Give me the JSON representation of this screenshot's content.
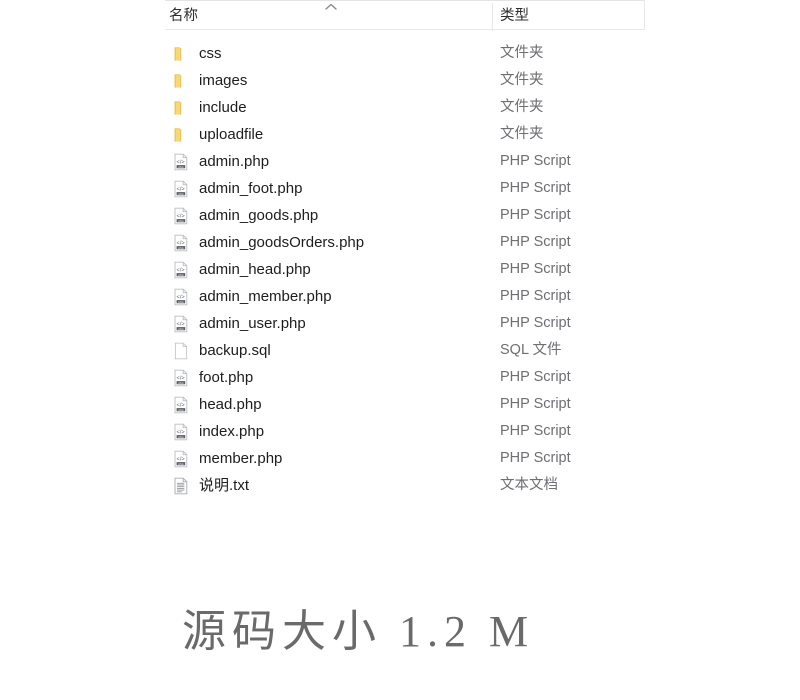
{
  "explorer": {
    "columns": {
      "name_label": "名称",
      "type_label": "类型",
      "sort_icon": "chevron-up-icon",
      "sort_direction": "ascending"
    },
    "rows": [
      {
        "name": "css",
        "type": "文件夹",
        "icon": "folder-icon"
      },
      {
        "name": "images",
        "type": "文件夹",
        "icon": "folder-icon"
      },
      {
        "name": "include",
        "type": "文件夹",
        "icon": "folder-icon"
      },
      {
        "name": "uploadfile",
        "type": "文件夹",
        "icon": "folder-icon"
      },
      {
        "name": "admin.php",
        "type": "PHP Script",
        "icon": "php-file-icon"
      },
      {
        "name": "admin_foot.php",
        "type": "PHP Script",
        "icon": "php-file-icon"
      },
      {
        "name": "admin_goods.php",
        "type": "PHP Script",
        "icon": "php-file-icon"
      },
      {
        "name": "admin_goodsOrders.php",
        "type": "PHP Script",
        "icon": "php-file-icon"
      },
      {
        "name": "admin_head.php",
        "type": "PHP Script",
        "icon": "php-file-icon"
      },
      {
        "name": "admin_member.php",
        "type": "PHP Script",
        "icon": "php-file-icon"
      },
      {
        "name": "admin_user.php",
        "type": "PHP Script",
        "icon": "php-file-icon"
      },
      {
        "name": "backup.sql",
        "type": "SQL 文件",
        "icon": "blank-file-icon"
      },
      {
        "name": "foot.php",
        "type": "PHP Script",
        "icon": "php-file-icon"
      },
      {
        "name": "head.php",
        "type": "PHP Script",
        "icon": "php-file-icon"
      },
      {
        "name": "index.php",
        "type": "PHP Script",
        "icon": "php-file-icon"
      },
      {
        "name": "member.php",
        "type": "PHP Script",
        "icon": "php-file-icon"
      },
      {
        "name": "说明.txt",
        "type": "文本文档",
        "icon": "text-file-icon"
      }
    ]
  },
  "caption": {
    "text": "源码大小 1.2 M"
  },
  "colors": {
    "folder": "#f7d77a",
    "grid_line": "#e6e8ec",
    "name_text": "#1d1d1d",
    "type_text": "#6e6e73",
    "caption_text": "#6a6a6a"
  }
}
